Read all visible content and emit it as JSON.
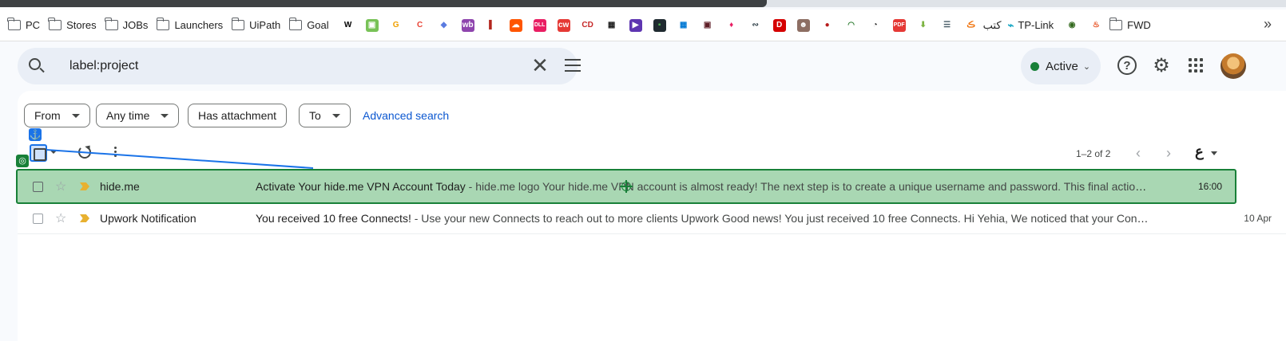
{
  "browser": {
    "bookmarks": {
      "folders": [
        "PC",
        "Stores",
        "JOBs",
        "Launchers",
        "UiPath",
        "Goal"
      ],
      "icons": [
        {
          "name": "wikipedia-icon",
          "glyph": "W",
          "bg": "#ffffff",
          "fg": "#000000"
        },
        {
          "name": "android-icon",
          "glyph": "▣",
          "bg": "#78c257",
          "fg": "#ffffff"
        },
        {
          "name": "g-icon",
          "glyph": "G",
          "bg": "#ffffff",
          "fg": "#f0a000"
        },
        {
          "name": "grammarly-icon",
          "glyph": "C",
          "bg": "#ffffff",
          "fg": "#e94335"
        },
        {
          "name": "drop-icon",
          "glyph": "◆",
          "bg": "#ffffff",
          "fg": "#5a7be0"
        },
        {
          "name": "wb-icon",
          "glyph": "wb",
          "bg": "#8e44ad",
          "fg": "#ffffff"
        },
        {
          "name": "bookmark-red-icon",
          "glyph": "▌",
          "bg": "#ffffff",
          "fg": "#b3261e"
        },
        {
          "name": "soundcloud-icon",
          "glyph": "☁",
          "bg": "#ff5500",
          "fg": "#ffffff"
        },
        {
          "name": "dll-icon",
          "glyph": "DLL",
          "bg": "#e91e63",
          "fg": "#ffffff"
        },
        {
          "name": "cw-icon",
          "glyph": "cw",
          "bg": "#e53935",
          "fg": "#ffffff"
        },
        {
          "name": "cd-icon",
          "glyph": "CD",
          "bg": "#ffffff",
          "fg": "#c62828"
        },
        {
          "name": "qr-icon",
          "glyph": "▦",
          "bg": "#ffffff",
          "fg": "#1f1f1f"
        },
        {
          "name": "play-icon",
          "glyph": "▶",
          "bg": "#5e35b1",
          "fg": "#ffffff"
        },
        {
          "name": "terminal-icon",
          "glyph": "▪",
          "bg": "#1f2a30",
          "fg": "#4caf50"
        },
        {
          "name": "microsoft-icon",
          "glyph": "▦",
          "bg": "#ffffff",
          "fg": "#0078d4"
        },
        {
          "name": "save-icon",
          "glyph": "▣",
          "bg": "#ffffff",
          "fg": "#5f1f28"
        },
        {
          "name": "flame-icon",
          "glyph": "♦",
          "bg": "#ffffff",
          "fg": "#e91e63"
        },
        {
          "name": "sketch-icon",
          "glyph": "∾",
          "bg": "#ffffff",
          "fg": "#37474f"
        },
        {
          "name": "d-icon",
          "glyph": "D",
          "bg": "#d50000",
          "fg": "#ffffff"
        },
        {
          "name": "portrait-icon",
          "glyph": "☻",
          "bg": "#8d6e63",
          "fg": "#ffffff"
        },
        {
          "name": "mask-icon",
          "glyph": "●",
          "bg": "#ffffff",
          "fg": "#b71c1c"
        },
        {
          "name": "rainbow-icon",
          "glyph": "◠",
          "bg": "#ffffff",
          "fg": "#2e7d32"
        },
        {
          "name": "speed-icon",
          "glyph": "◔",
          "bg": "#ffffff",
          "fg": "#1f1f1f"
        },
        {
          "name": "pdf-jpg-icon",
          "glyph": "PDF",
          "bg": "#e53935",
          "fg": "#ffffff"
        },
        {
          "name": "download-icon",
          "glyph": "⬇",
          "bg": "#ffffff",
          "fg": "#7cb342"
        },
        {
          "name": "document-icon",
          "glyph": "☰",
          "bg": "#ffffff",
          "fg": "#455a64"
        },
        {
          "name": "arabic-s-icon",
          "glyph": "ڪ",
          "bg": "#ffffff",
          "fg": "#ef6c00"
        }
      ],
      "text_link": "كتب",
      "tplink_label": "TP-Link",
      "after_icons": [
        {
          "name": "badge-icon",
          "glyph": "◉",
          "bg": "#ffffff",
          "fg": "#33691e"
        },
        {
          "name": "fire-icon",
          "glyph": "♨",
          "bg": "#ffffff",
          "fg": "#e64a19"
        }
      ],
      "last_folder": "FWD",
      "overflow": "»"
    }
  },
  "search": {
    "value": "label:project",
    "clear": "✕"
  },
  "status": {
    "label": "Active",
    "color": "#188038"
  },
  "header_icons": {
    "help": "?",
    "settings": "⚙"
  },
  "filters": {
    "from": "From",
    "any_time": "Any time",
    "has_attachment": "Has attachment",
    "to": "To",
    "advanced": "Advanced search"
  },
  "toolbar": {
    "anchor": "⚓",
    "target": "◎",
    "range": "1–2 of 2",
    "prev": "‹",
    "next": "›",
    "lang": "ع"
  },
  "emails": [
    {
      "sender": "hide.me",
      "subject": "Activate Your hide.me VPN Account Today",
      "snippet": " - hide.me logo Your hide.me VPN account is almost ready! The next step is to create a unique username and password. This final action is...",
      "date": "16:00",
      "highlighted": true
    },
    {
      "sender": "Upwork Notification",
      "subject": "You received 10 free Connects!",
      "snippet": " - Use your new Connects to reach out to more clients Upwork Good news! You just received 10 free Connects. Hi Yehia, We noticed that your Conne...",
      "date": "10 Apr",
      "highlighted": false
    }
  ],
  "colors": {
    "accent_blue": "#1a73e8",
    "highlight_green": "#a9d7b3",
    "highlight_border": "#188038",
    "importance": "#e8b130"
  }
}
